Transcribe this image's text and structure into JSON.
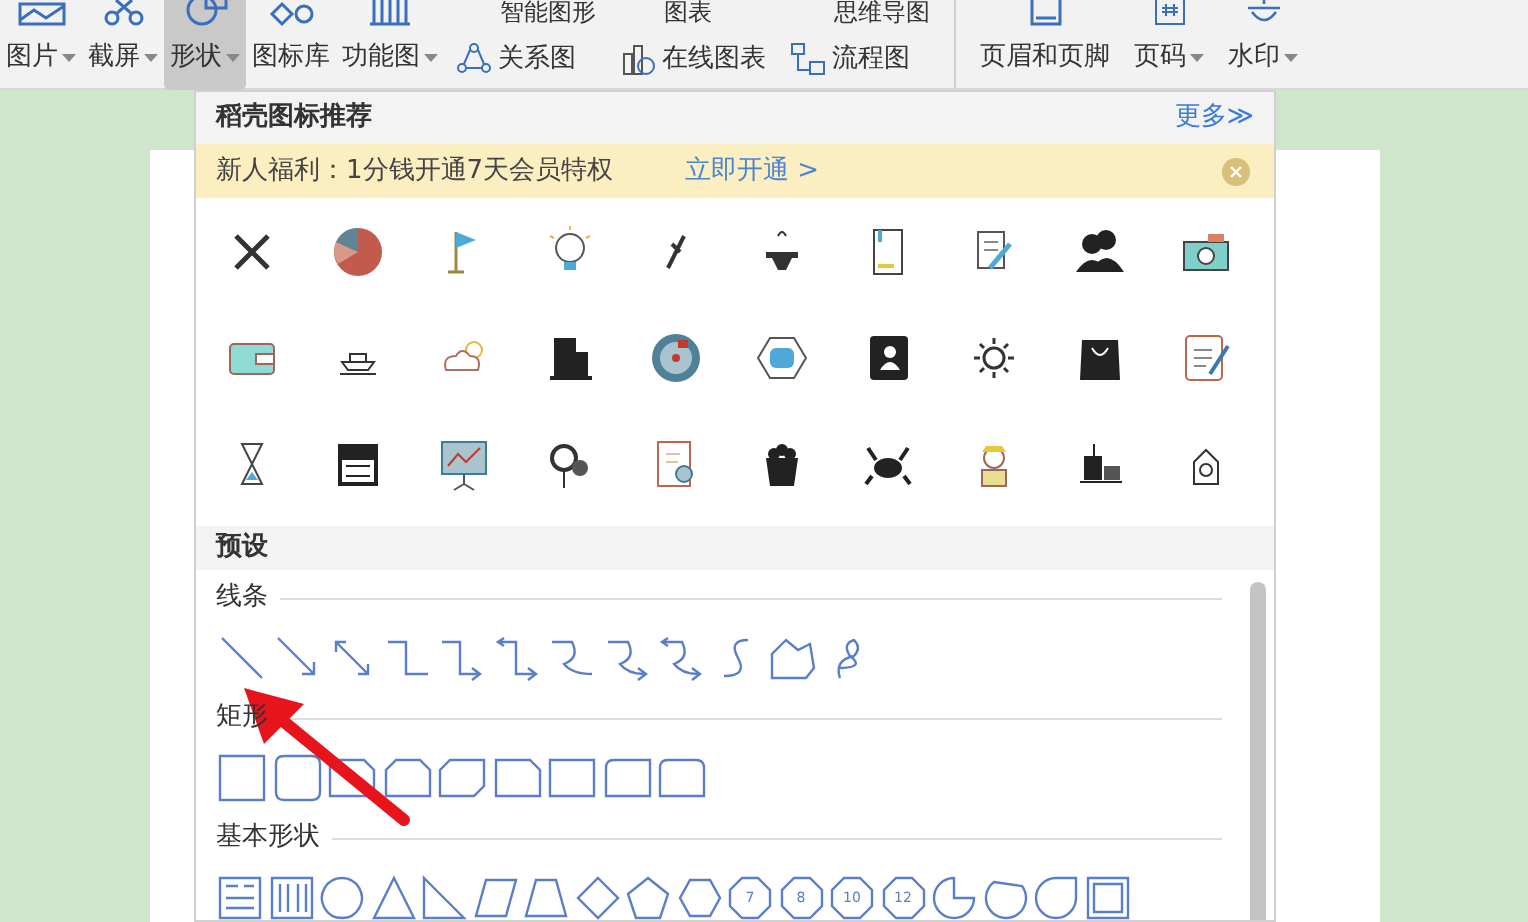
{
  "ribbon": {
    "items": [
      {
        "label": "图片",
        "dropdown": true,
        "selected": false
      },
      {
        "label": "截屏",
        "dropdown": true,
        "selected": false
      },
      {
        "label": "形状",
        "dropdown": true,
        "selected": true
      },
      {
        "label": "图标库",
        "dropdown": false,
        "selected": false
      },
      {
        "label": "功能图",
        "dropdown": true,
        "selected": false
      }
    ],
    "small_groups": [
      {
        "top": "智能图形",
        "bottom": "关系图"
      },
      {
        "top": "图表",
        "bottom": "在线图表"
      },
      {
        "top": "思维导图",
        "bottom": "流程图"
      }
    ],
    "right_items": [
      {
        "label": "页眉和页脚",
        "dropdown": false
      },
      {
        "label": "页码",
        "dropdown": true
      },
      {
        "label": "水印",
        "dropdown": true
      }
    ]
  },
  "shape_menu": {
    "title": "稻壳图标推荐",
    "more_link": "更多≫",
    "promo": {
      "text": "新人福利：1分钱开通7天会员特权",
      "link": "立即开通 >"
    },
    "preset_title": "预设",
    "sections": [
      {
        "title": "线条",
        "kind": "lines"
      },
      {
        "title": "矩形",
        "kind": "rectangles"
      },
      {
        "title": "基本形状",
        "kind": "basic"
      }
    ],
    "basic_shapes": [
      {
        "kind": "text-box"
      },
      {
        "kind": "vertical-text-box"
      },
      {
        "kind": "ellipse"
      },
      {
        "kind": "triangle"
      },
      {
        "kind": "right-triangle"
      },
      {
        "kind": "parallelogram"
      },
      {
        "kind": "trapezoid"
      },
      {
        "kind": "diamond"
      },
      {
        "kind": "pentagon"
      },
      {
        "kind": "hexagon"
      },
      {
        "kind": "polygon",
        "label": "7"
      },
      {
        "kind": "polygon",
        "label": "8"
      },
      {
        "kind": "polygon",
        "label": "10"
      },
      {
        "kind": "polygon",
        "label": "12"
      },
      {
        "kind": "pie"
      },
      {
        "kind": "chord"
      },
      {
        "kind": "teardrop"
      },
      {
        "kind": "frame"
      }
    ]
  }
}
